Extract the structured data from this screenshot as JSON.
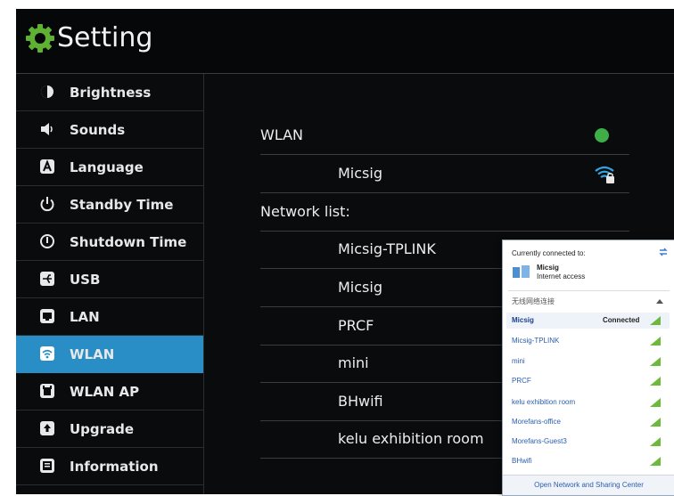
{
  "header": {
    "title": "Setting",
    "icon": "gear-icon",
    "accent": "#5fb134"
  },
  "sidebar": {
    "active_index": 7,
    "active_color": "#2a8ec6",
    "items": [
      {
        "label": "Brightness",
        "icon": "brightness-icon"
      },
      {
        "label": "Sounds",
        "icon": "speaker-icon"
      },
      {
        "label": "Language",
        "icon": "language-icon"
      },
      {
        "label": "Standby Time",
        "icon": "power-icon"
      },
      {
        "label": "Shutdown Time",
        "icon": "shutdown-icon"
      },
      {
        "label": "USB",
        "icon": "usb-icon"
      },
      {
        "label": "LAN",
        "icon": "lan-icon"
      },
      {
        "label": "WLAN",
        "icon": "wifi-icon"
      },
      {
        "label": "WLAN AP",
        "icon": "access-point-icon"
      },
      {
        "label": "Upgrade",
        "icon": "upgrade-icon"
      },
      {
        "label": "Information",
        "icon": "information-icon"
      }
    ]
  },
  "wlan": {
    "label": "WLAN",
    "enabled": true,
    "toggle_color": "#3fae49",
    "connected_network": "Micsig",
    "network_list_label": "Network list:",
    "networks": [
      "Micsig-TPLINK",
      "Micsig",
      "PRCF",
      "mini",
      "BHwifi",
      "kelu exhibition room"
    ]
  },
  "popup": {
    "currently_connected_to": "Currently connected to:",
    "network_name": "Micsig",
    "network_status": "Internet access",
    "section_label": "无线网络连接",
    "connected_label": "Connected",
    "networks": [
      "Micsig",
      "Micsig-TPLINK",
      "mini",
      "PRCF",
      "kelu exhibition room",
      "Morefans-office",
      "Morefans-Guest3",
      "BHwifi"
    ],
    "footer_link": "Open Network and Sharing Center"
  }
}
